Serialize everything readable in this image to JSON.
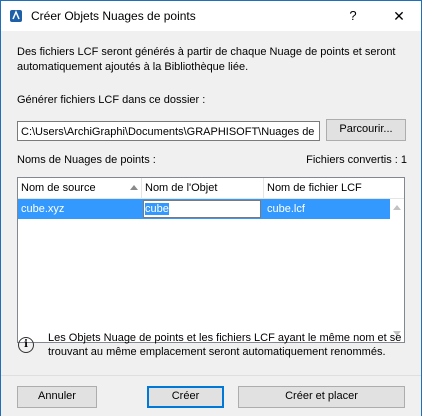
{
  "window": {
    "title": "Créer Objets Nuages de points",
    "help_label": "?",
    "close_label": "✕"
  },
  "intro": "Des fichiers LCF seront générés à partir de chaque Nuage de points et seront automatiquement ajoutés à la Bibliothèque liée.",
  "folder": {
    "label": "Générer fichiers LCF dans ce dossier :",
    "path": "C:\\Users\\ArchiGraphi\\Documents\\GRAPHISOFT\\Nuages de",
    "browse_label": "Parcourir..."
  },
  "table": {
    "title": "Noms de Nuages de points :",
    "converted": "Fichiers convertis : 1",
    "columns": [
      "Nom de source",
      "Nom de l'Objet",
      "Nom de fichier LCF"
    ],
    "rows": [
      {
        "source": "cube.xyz",
        "object": "cube",
        "lcf": "cube.lcf"
      }
    ]
  },
  "info": "Les Objets Nuage de points et les fichiers LCF ayant le même nom et se trouvant au même emplacement seront automatiquement renommés.",
  "footer": {
    "cancel": "Annuler",
    "create": "Créer",
    "create_place": "Créer et placer"
  },
  "colors": {
    "selection": "#3399ff",
    "default_button_border": "#0078d7",
    "window_border": "#1f6fb9"
  },
  "icons": {
    "app": "app-icon",
    "sort": "sort-ascending-icon",
    "info": "info-icon"
  }
}
